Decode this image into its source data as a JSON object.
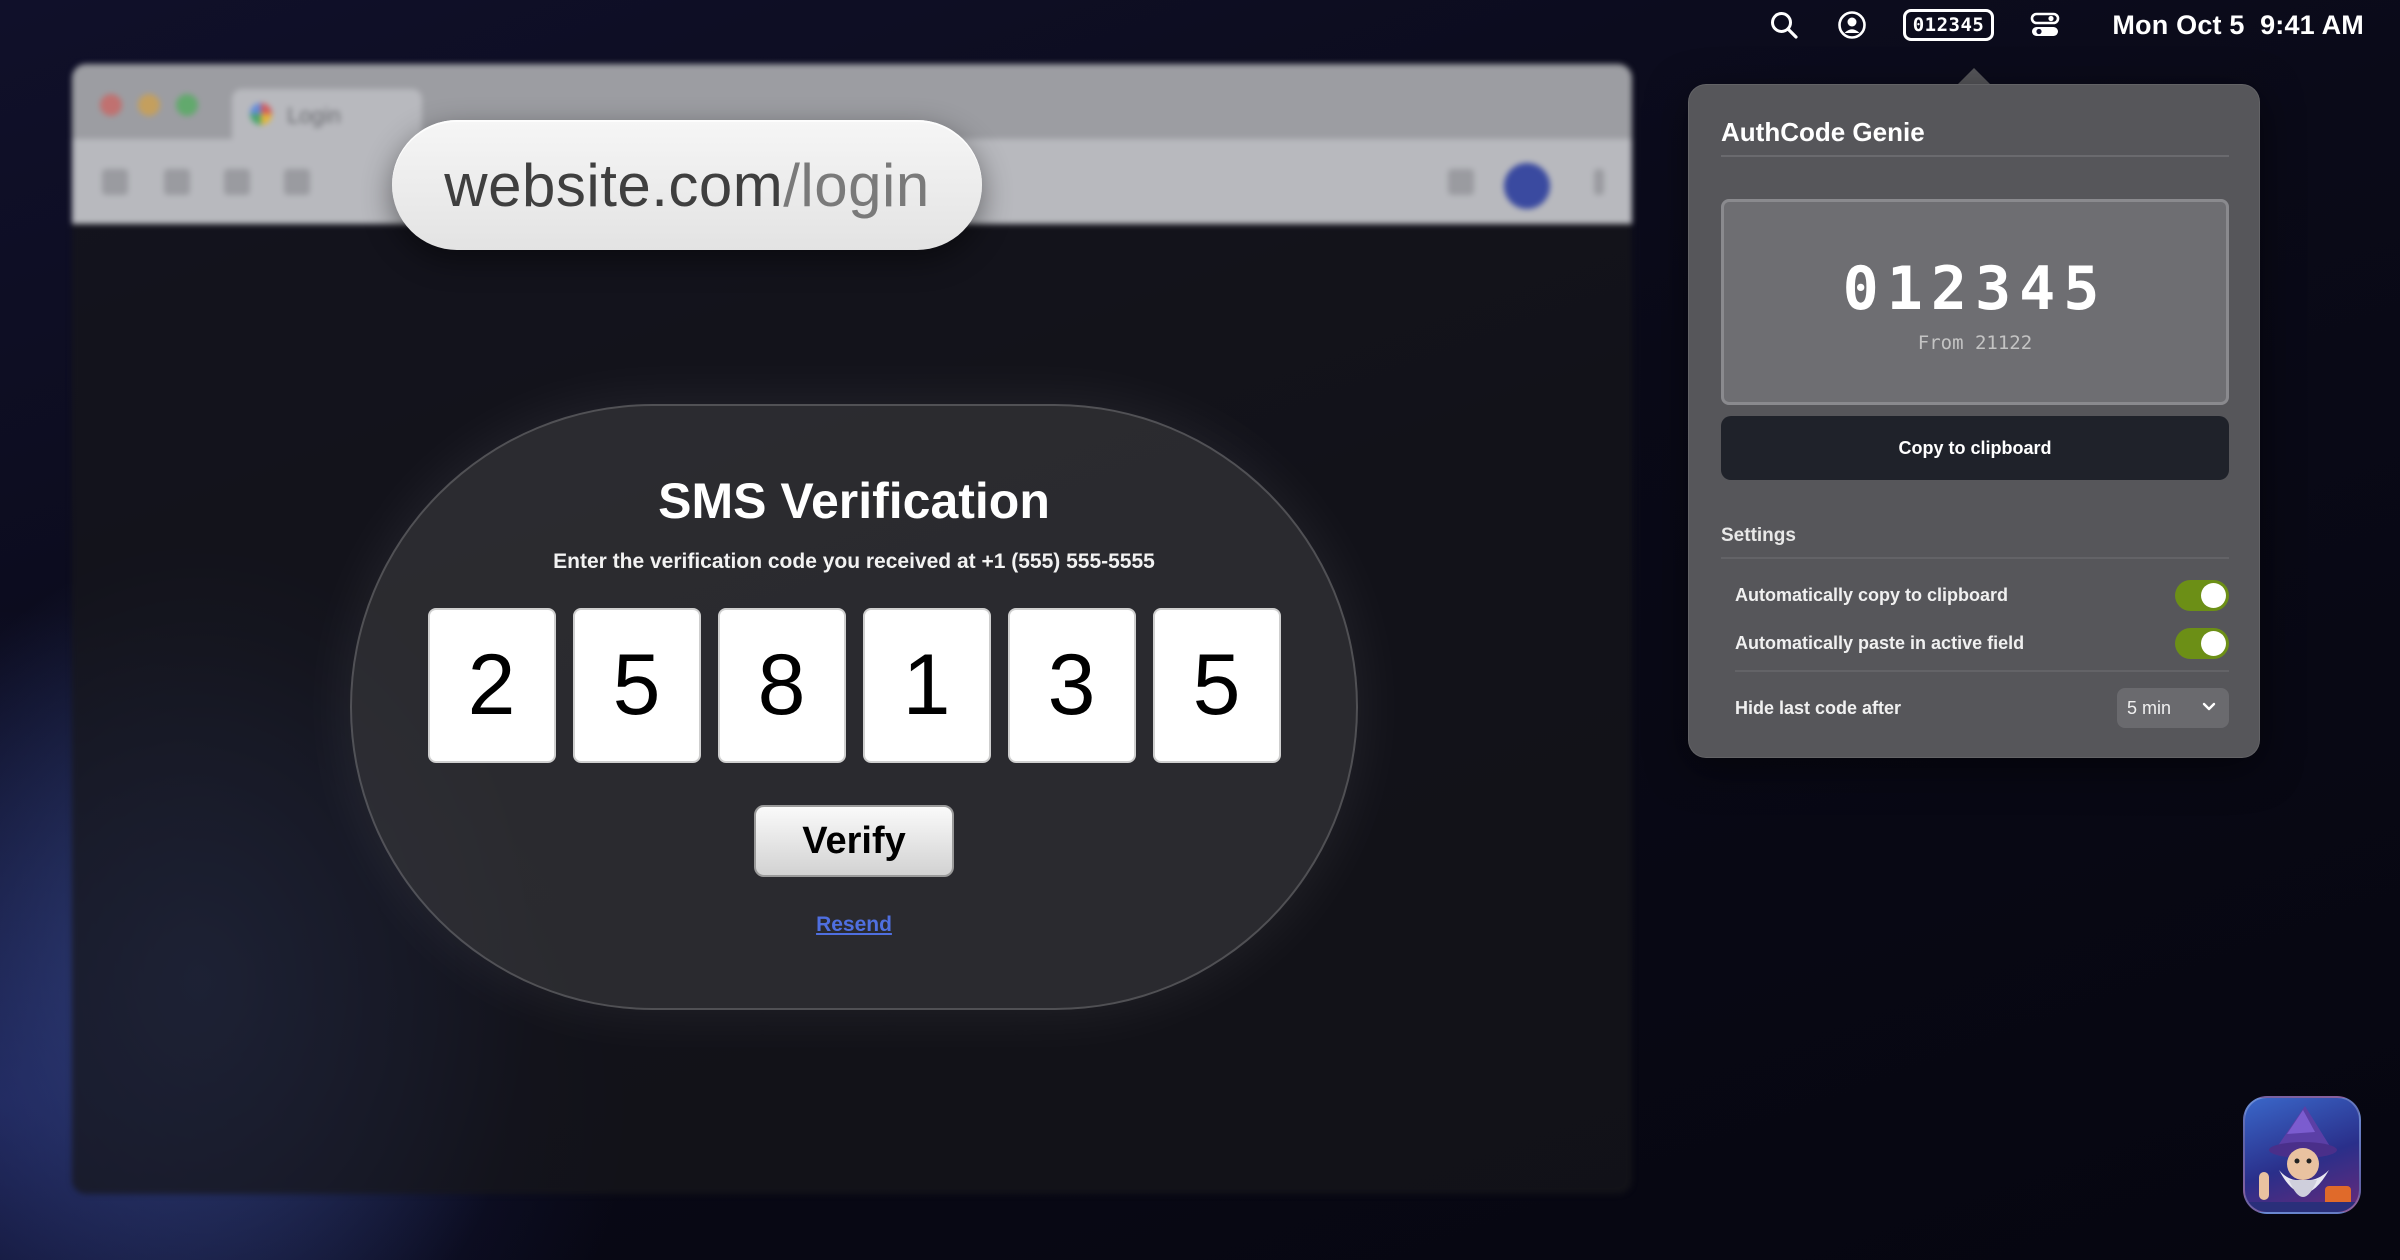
{
  "menubar": {
    "code_badge": "012345",
    "date": "Mon Oct 5",
    "time": "9:41 AM"
  },
  "background_browser": {
    "tab_title": "Login"
  },
  "url": {
    "domain": "website.com",
    "path": "/login"
  },
  "verification": {
    "title": "SMS Verification",
    "subtitle": "Enter the verification code you received at +1 (555) 555-5555",
    "digits": [
      "2",
      "5",
      "8",
      "1",
      "3",
      "5"
    ],
    "verify_label": "Verify",
    "resend_label": "Resend"
  },
  "popover": {
    "title": "AuthCode Genie",
    "code": "012345",
    "from": "From 21122",
    "copy_label": "Copy to clipboard",
    "settings_label": "Settings",
    "settings": [
      {
        "label": "Automatically copy to clipboard",
        "enabled": true
      },
      {
        "label": "Automatically paste in active field",
        "enabled": true
      }
    ],
    "hide_label": "Hide last code after",
    "hide_value": "5 min"
  },
  "colors": {
    "toggle_on": "#6c8f16",
    "link": "#4f6fe0",
    "copy_button": "#1f222a"
  },
  "icons": [
    "search-icon",
    "user-circle-icon",
    "control-center-icon",
    "chevron-down-icon",
    "wizard-app-icon"
  ]
}
